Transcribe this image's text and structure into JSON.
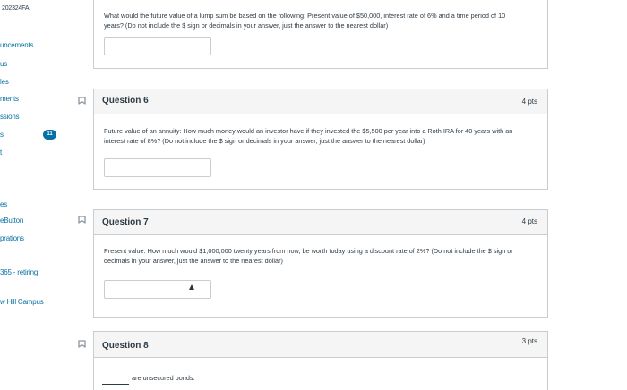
{
  "sidebar": {
    "course_code": "202324FA",
    "items": [
      {
        "label": "uncements"
      },
      {
        "label": "us"
      },
      {
        "label": "les"
      },
      {
        "label": "ments"
      },
      {
        "label": "ssions"
      },
      {
        "label": "s"
      },
      {
        "label": "t"
      },
      {
        "label": "es"
      },
      {
        "label": "eButton"
      },
      {
        "label": "prations"
      },
      {
        "label": "365 - retiring"
      },
      {
        "label": "w Hill Campus"
      }
    ],
    "badge_count": "11"
  },
  "questions": [
    {
      "title": "",
      "points": "",
      "text": "What would the future value of a lump sum be based on the following: Present value of $50,000, interest rate of 6% and a time period of 10 years? (Do not include the $ sign or decimals in your answer, just the answer to the nearest dollar)",
      "answer_value": ""
    },
    {
      "title": "Question 6",
      "points": "4 pts",
      "text": "Future value of an annuity: How much money would an investor have if they invested the $5,500 per year into a Roth IRA for 40 years with an interest rate of 8%? (Do not include the $ sign or decimals in your answer, just the answer to the nearest dollar)",
      "answer_value": ""
    },
    {
      "title": "Question 7",
      "points": "4 pts",
      "text": "Present value: How much would $1,000,000 twenty years from now, be worth today using a discount rate of 2%? (Do not include the $ sign or decimals in your answer, just the answer to the nearest dollar)",
      "answer_value": ""
    },
    {
      "title": "Question 8",
      "points": "3 pts",
      "text": "are unsecured bonds.",
      "answer_value": ""
    }
  ],
  "colors": {
    "link": "#0770a3",
    "border": "#c7cdd1",
    "header_bg": "#f5f5f5"
  },
  "icons": {
    "flag": "flag-icon"
  }
}
